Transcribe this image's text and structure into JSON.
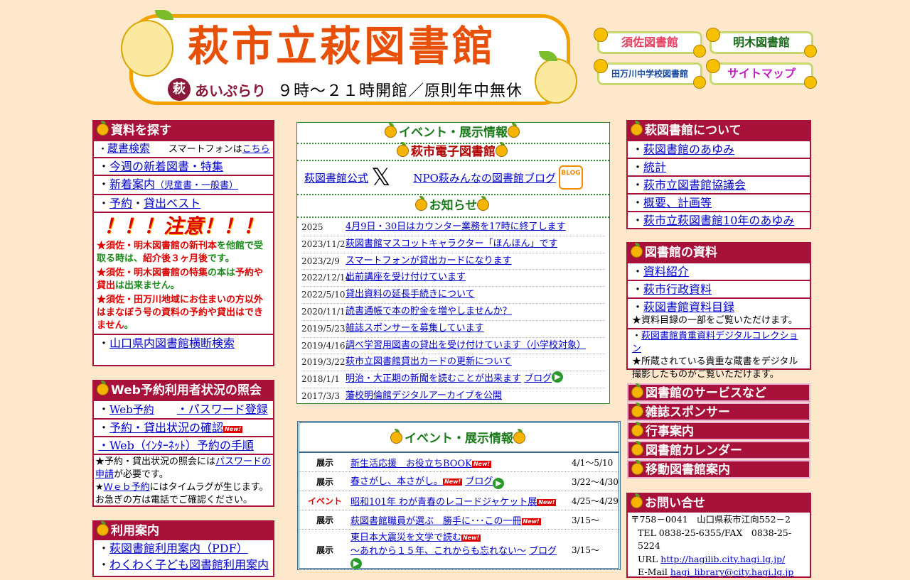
{
  "header": {
    "title": "萩市立萩図書館",
    "logo_mark": "萩",
    "logo_text": "あいぷらり",
    "hours": "９時～２１時開館／原則年中無休"
  },
  "side_links": [
    {
      "label": "須佐図書館",
      "color": "#e84060"
    },
    {
      "label": "明木図書館",
      "color": "#1a6a1a"
    },
    {
      "label": "田万川中学校図書館",
      "color": "#1a4aa0"
    },
    {
      "label": "サイトマップ",
      "color": "#c020c0"
    }
  ],
  "search_box": {
    "title": "資料を探す",
    "catalog": "蔵書検索",
    "smartphone_prefix": "スマートフォンは",
    "smartphone_link": "こちら",
    "new_books": "今週の新着図書・特集",
    "new_guide": "新着案内",
    "new_guide_sub": "（児童書・一般書）",
    "reserve": "予約",
    "best": "貸出ベスト",
    "warning": "！！！注意！！！",
    "notes": [
      [
        "★須佐・明木図書館の",
        "新刊本",
        "を他館で受取る時は、",
        "紹介後３ヶ月後",
        "です。"
      ],
      [
        "★須佐・明木図書館の",
        "特集",
        "の本は",
        "予約や貸出",
        "は出来ません。"
      ],
      [
        "★須佐・田万川地域にお住まいの方以外はまなぼう号の資料の予約や貸出はできません",
        "。"
      ]
    ],
    "yamaguchi": "山口県内図書館横断検索"
  },
  "web_box": {
    "title": "Web予約利用者状況の照会",
    "web_reserve": "Web予約",
    "password": "・パスワード登録",
    "status": "予約・貸出状況の確認",
    "procedure": "・Web（ｲﾝﾀｰﾈｯﾄ）予約の手順",
    "note1_pre": "★予約・貸出状況の照会には",
    "note1_link": "パスワードの申請",
    "note1_post": "が必要です。",
    "note2_link": "Ｗｅｂ予約",
    "note2_post": "にはタイムラグが生じます。お急ぎの方は電話でご確認ください。",
    "note2_pre": "★"
  },
  "usage_box": {
    "title": "利用案内",
    "items": [
      "萩図書館利用案内（PDF）",
      "わくわく子ども図書館利用案内"
    ]
  },
  "center": {
    "events_head": "イベント・展示情報",
    "ebook_head": "萩市電子図書館",
    "official": "萩図書館公式",
    "x_mark": "𝕏",
    "npo_blog": "NPO萩みんなの図書館ブログ",
    "blog_badge": "BLOG",
    "notice_head": "お知らせ",
    "news": [
      {
        "date": "2025",
        "text": "4月9日・30日はカウンター業務を17時に終了します"
      },
      {
        "date": "2023/11/2",
        "text": "萩図書館マスコットキャラクター「ほんほん」です"
      },
      {
        "date": "2023/2/9",
        "text": "スマートフォンが貸出カードになります"
      },
      {
        "date": "2022/12/14",
        "text": "出前講座を受け付けています"
      },
      {
        "date": "2022/5/10",
        "text": "貸出資料の延長手続きについて"
      },
      {
        "date": "2020/11/1",
        "text": "読書通帳で本の貯金を増やしませんか？"
      },
      {
        "date": "2019/5/23",
        "text": "雑誌スポンサーを募集しています"
      },
      {
        "date": "2019/4/16",
        "text": "調べ学習用図書の貸出を受け付けています（小学校対象）"
      },
      {
        "date": "2019/3/22",
        "text": "萩市立図書館貸出カードの更新について"
      },
      {
        "date": "2018/1/1",
        "text": "明治・大正期の新聞を読むことが出来ます",
        "extra": "ブログ"
      },
      {
        "date": "2017/3/3",
        "text": "藩校明倫館デジタルアーカイブを公開"
      }
    ],
    "events_head2": "イベント・展示情報",
    "new_badge": "New!",
    "blog_word": "ブログ",
    "events": [
      {
        "kind": "展示",
        "title": "新生活応援　お役立ちBOOK",
        "period": "4/1～5/10",
        "kind_color": "#000",
        "new": true
      },
      {
        "kind": "展示",
        "title": "春さがし、本さがし。",
        "extra": "ブログ",
        "period": "3/22～4/30",
        "kind_color": "#000",
        "new": true
      },
      {
        "kind": "イベント",
        "title": "昭和101年 わが青春のレコードジャケット展",
        "period": "4/25～4/29",
        "kind_color": "#e00000",
        "new": true
      },
      {
        "kind": "展示",
        "title": "萩図書館職員が選ぶ　勝手に･･･この一冊",
        "period": "3/15～",
        "kind_color": "#000",
        "new": true
      },
      {
        "kind": "展示",
        "title": "東日本大震災を文学で読む",
        "subtitle": "～あれから１５年、これからも忘れない～",
        "extra": "ブログ",
        "period": "3/15～",
        "kind_color": "#000",
        "new": true
      }
    ]
  },
  "about_box": {
    "title": "萩図書館について",
    "items": [
      "萩図書館のあゆみ",
      "統計",
      "萩市立図書館協議会",
      "概要、計画等",
      "萩市立萩図書館10年のあゆみ"
    ]
  },
  "materials_box": {
    "title": "図書館の資料",
    "items": [
      "資料紹介",
      "萩市行政資料",
      "萩図書館資料目録"
    ],
    "note1": "★資料目録の一部をご覧いただけます。",
    "digital": "萩図書館貴重資料デジタルコレクション",
    "note2": "★所蔵されている貴重な蔵書をデジタル撮影したものがご覧いただけます。"
  },
  "service_buttons": [
    "図書館のサービスなど",
    "雑誌スポンサー",
    "行事案内",
    "図書館カレンダー",
    "移動図書館案内"
  ],
  "contact_box": {
    "title": "お問い合せ",
    "address": "〒758－0041　山口県萩市江向552－2",
    "tel": "TEL 0838-25-6355/FAX　0838-25-5224",
    "url_label": "URL",
    "url": "http://hagilib.city.hagi.lg.jp/",
    "email_label": "E-Mail",
    "email": "hagi_library@city.hagi.lg.jp"
  }
}
